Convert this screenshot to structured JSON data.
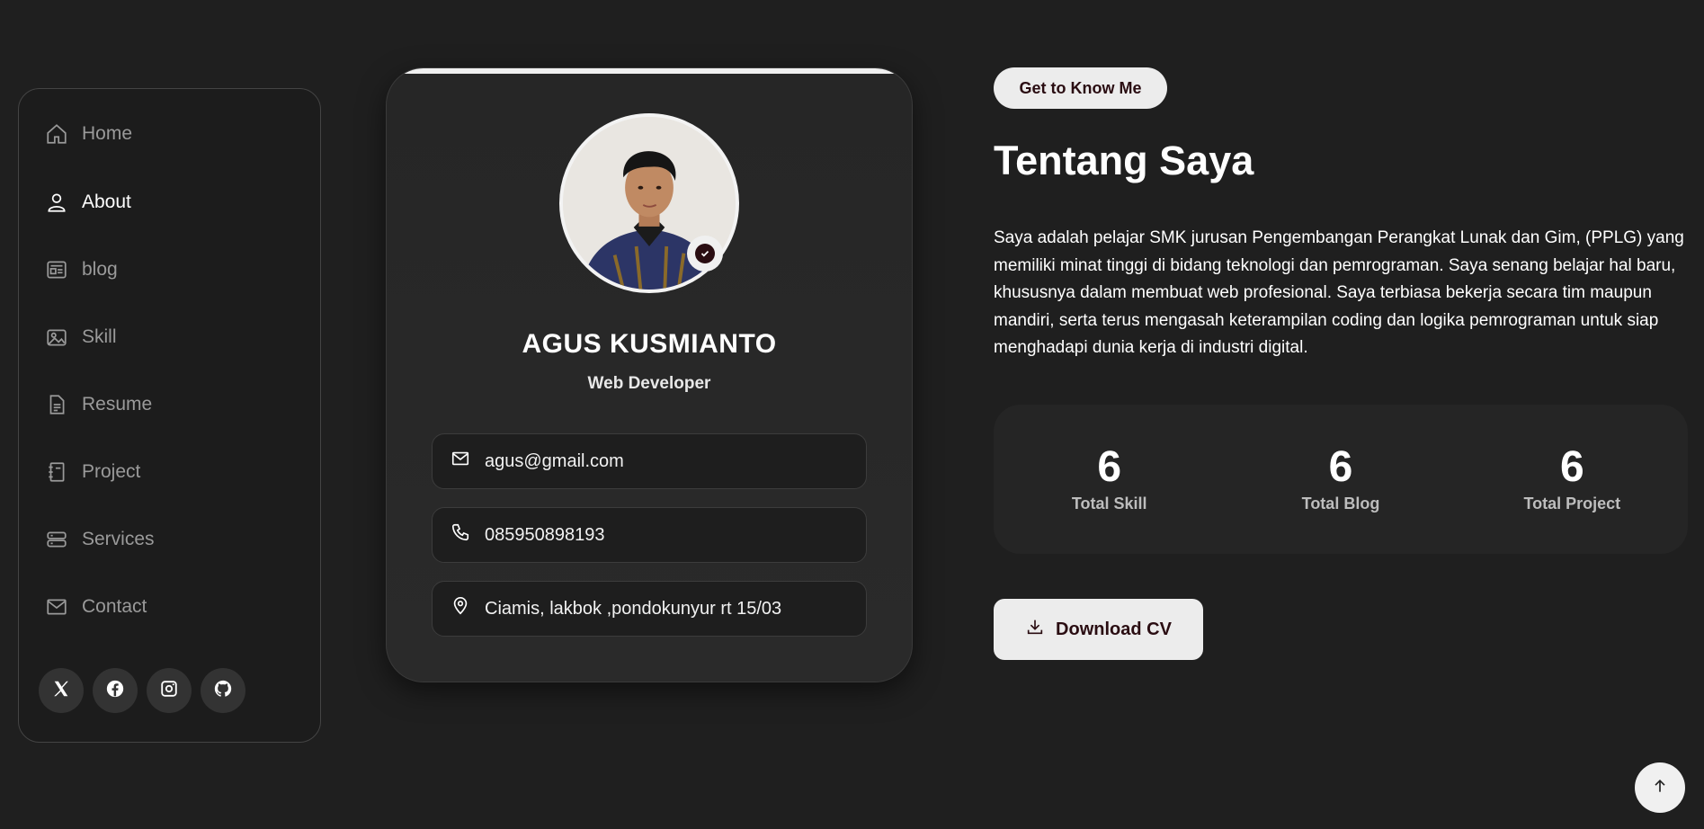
{
  "sidebar": {
    "items": [
      {
        "label": "Home",
        "icon": "home-icon"
      },
      {
        "label": "About",
        "icon": "user-icon",
        "active": true
      },
      {
        "label": "blog",
        "icon": "newspaper-icon"
      },
      {
        "label": "Skill",
        "icon": "image-icon"
      },
      {
        "label": "Resume",
        "icon": "document-icon"
      },
      {
        "label": "Project",
        "icon": "notebook-icon"
      },
      {
        "label": "Services",
        "icon": "server-icon"
      },
      {
        "label": "Contact",
        "icon": "envelope-icon"
      }
    ],
    "socials": [
      "x-icon",
      "facebook-icon",
      "instagram-icon",
      "github-icon"
    ]
  },
  "profile": {
    "name": "AGUS KUSMIANTO",
    "role": "Web Developer",
    "email": "agus@gmail.com",
    "phone": "085950898193",
    "address": "Ciamis, lakbok ,pondokunyur rt 15/03"
  },
  "about": {
    "badge": "Get to Know Me",
    "title": "Tentang Saya",
    "description": "Saya adalah pelajar SMK jurusan Pengembangan Perangkat Lunak dan Gim, (PPLG) yang memiliki minat tinggi di bidang teknologi dan pemrograman. Saya senang belajar hal baru, khususnya dalam membuat web profesional. Saya terbiasa bekerja secara tim maupun mandiri, serta terus mengasah keterampilan coding dan logika pemrograman untuk siap menghadapi dunia kerja di industri digital."
  },
  "stats": [
    {
      "value": "6",
      "label": "Total Skill"
    },
    {
      "value": "6",
      "label": "Total Blog"
    },
    {
      "value": "6",
      "label": "Total Project"
    }
  ],
  "download_label": "Download CV",
  "colors": {
    "background": "#1f1f1f",
    "accent_light": "#ececec",
    "accent_dark": "#2a0d12"
  }
}
